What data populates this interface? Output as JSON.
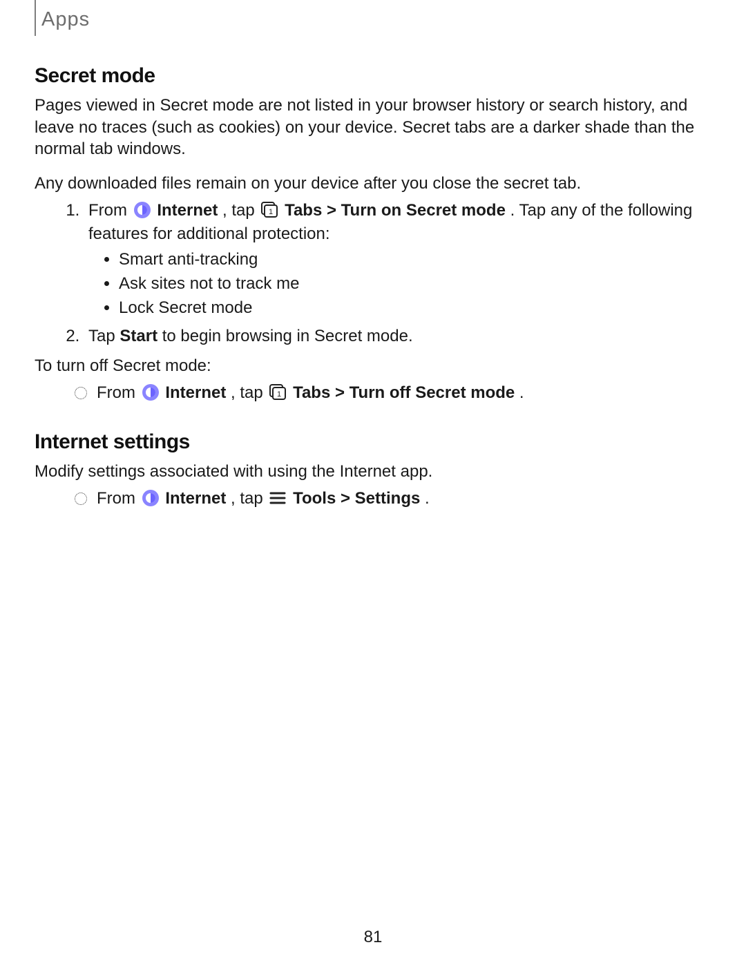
{
  "header": {
    "title": "Apps"
  },
  "section1": {
    "heading": "Secret mode",
    "para1": "Pages viewed in Secret mode are not listed in your browser history or search history, and leave no traces (such as cookies) on your device. Secret tabs are a darker shade than the normal tab windows.",
    "para2": "Any downloaded files remain on your device after you close the secret tab.",
    "step1": {
      "pre": "From ",
      "internet_label": "Internet",
      "mid1": ", tap ",
      "tabs_label": "Tabs",
      "sep": " > ",
      "action": "Turn on Secret mode",
      "post": ". Tap any of the following features for additional protection:"
    },
    "bullets": [
      "Smart anti-tracking",
      "Ask sites not to track me",
      "Lock Secret mode"
    ],
    "step2": {
      "pre": "Tap ",
      "start": "Start",
      "post": " to begin browsing in Secret mode."
    },
    "turnoff_intro": "To turn off Secret mode:",
    "turnoff": {
      "pre": "From ",
      "internet_label": "Internet",
      "mid1": ", tap ",
      "tabs_label": "Tabs",
      "sep": " > ",
      "action": "Turn off Secret mode",
      "post": "."
    }
  },
  "section2": {
    "heading": "Internet settings",
    "para": "Modify settings associated with using the Internet app.",
    "step": {
      "pre": "From ",
      "internet_label": "Internet",
      "mid1": ", tap ",
      "tools_label": "Tools",
      "sep": " > ",
      "settings_label": "Settings",
      "post": "."
    }
  },
  "footer": {
    "page_number": "81"
  }
}
